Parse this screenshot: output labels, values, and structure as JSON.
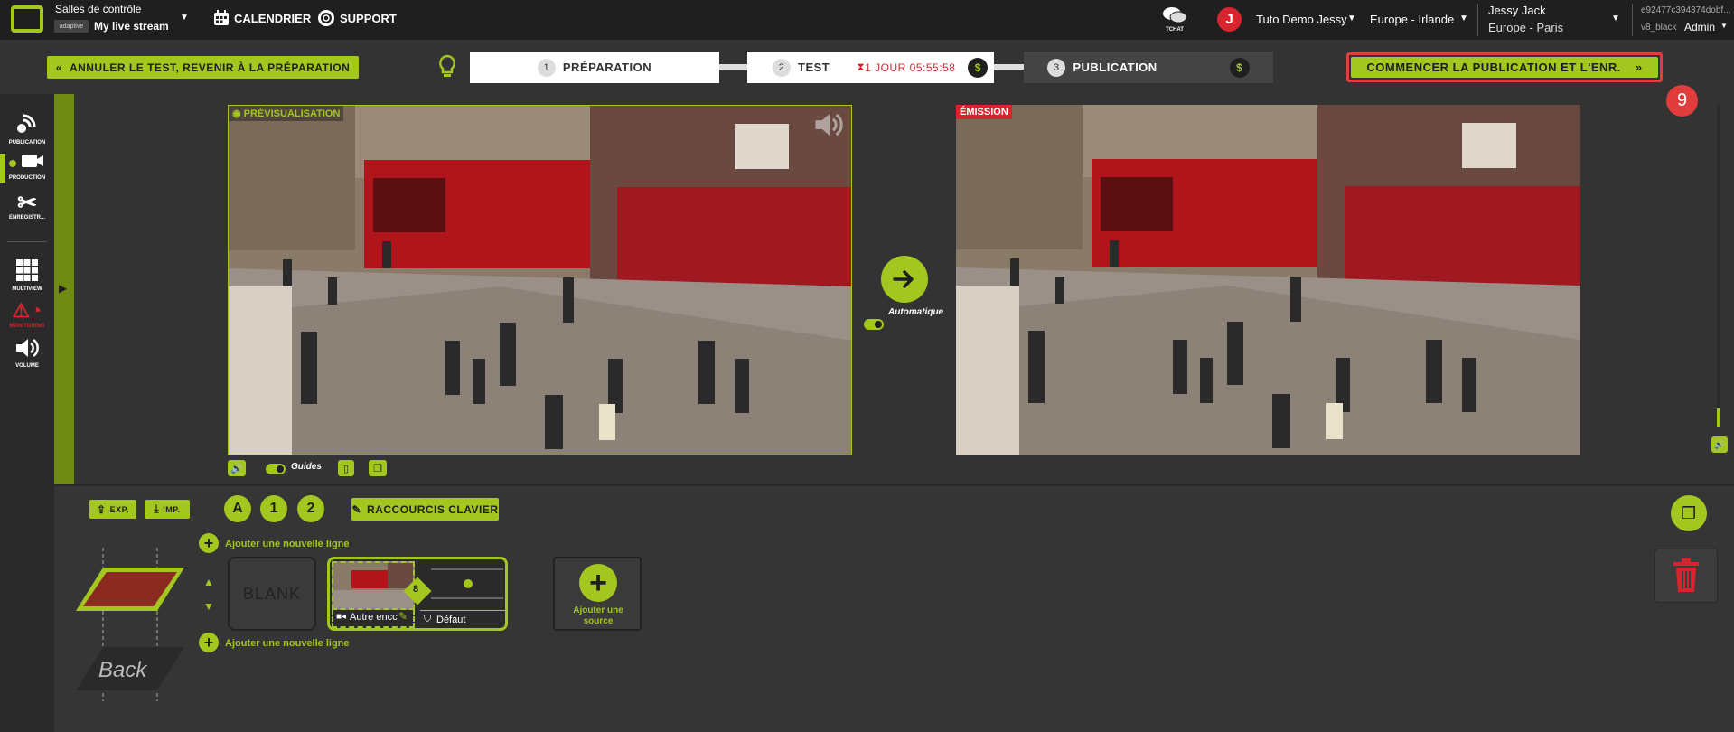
{
  "topbar": {
    "org_title": "Salles de contrôle",
    "stream_brand": "adaptive",
    "stream_name": "My live stream",
    "calendar": "CALENDRIER",
    "support": "SUPPORT",
    "tchat": "TCHAT",
    "avatar_initial": "J",
    "workspace": "Tuto Demo Jessy",
    "region": "Europe - Irlande",
    "user_name": "Jessy Jack",
    "user_tz": "Europe - Paris",
    "id_text": "e92477c394374dobf...",
    "skin": "v8_black",
    "role": "Admin"
  },
  "steps": {
    "cancel_label": "ANNULER LE TEST, REVENIR À LA PRÉPARATION",
    "step1_num": "1",
    "step1_label": "PRÉPARATION",
    "step2_num": "2",
    "step2_label": "TEST",
    "timer": "1 JOUR 05:55:58",
    "step3_num": "3",
    "step3_label": "PUBLICATION",
    "dollar": "$",
    "publish_label": "COMMENCER LA PUBLICATION ET L'ENR.",
    "callout": "9"
  },
  "sidebar": {
    "items": [
      {
        "label": "PUBLICATION"
      },
      {
        "label": "PRODUCTION"
      },
      {
        "label": "ENREGISTR..."
      },
      {
        "label": "MULTIVIEW"
      },
      {
        "label": "MONITORING"
      },
      {
        "label": "VOLUME"
      }
    ]
  },
  "preview": {
    "label": "PRÉVISUALISATION",
    "guides": "Guides"
  },
  "program": {
    "label": "ÉMISSION"
  },
  "transition": {
    "auto_label": "Automatique"
  },
  "bottom": {
    "exp": "EXP.",
    "imp": "IMP.",
    "layer_a": "A",
    "layer_1": "1",
    "layer_2": "2",
    "shortcuts": "RACCOURCIS CLAVIER",
    "add_line": "Ajouter une nouvelle ligne",
    "blank": "BLANK",
    "source_name": "Autre encc",
    "source_num": "8",
    "default_label": "Défaut",
    "add_source": "Ajouter une source",
    "back": "Back"
  },
  "colors": {
    "accent": "#a3c71e",
    "danger": "#d7242e",
    "bg": "#333333"
  }
}
